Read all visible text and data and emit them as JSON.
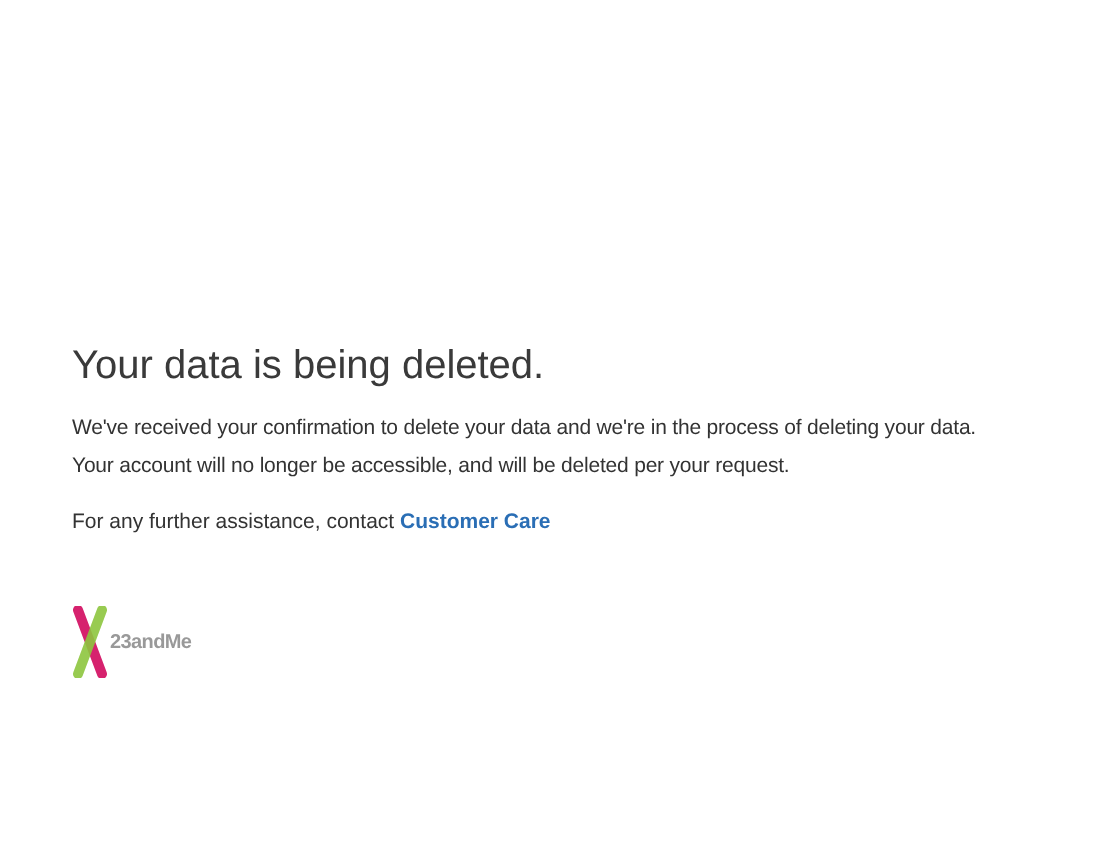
{
  "heading": "Your data is being deleted.",
  "body": [
    "We've received your confirmation to delete your data and we're in the process of deleting your data.",
    "Your account will no longer be accessible, and will be deleted per your request."
  ],
  "contact": {
    "text": "For any further assistance, contact ",
    "link": "Customer Care"
  },
  "logo": {
    "text": "23andMe"
  }
}
